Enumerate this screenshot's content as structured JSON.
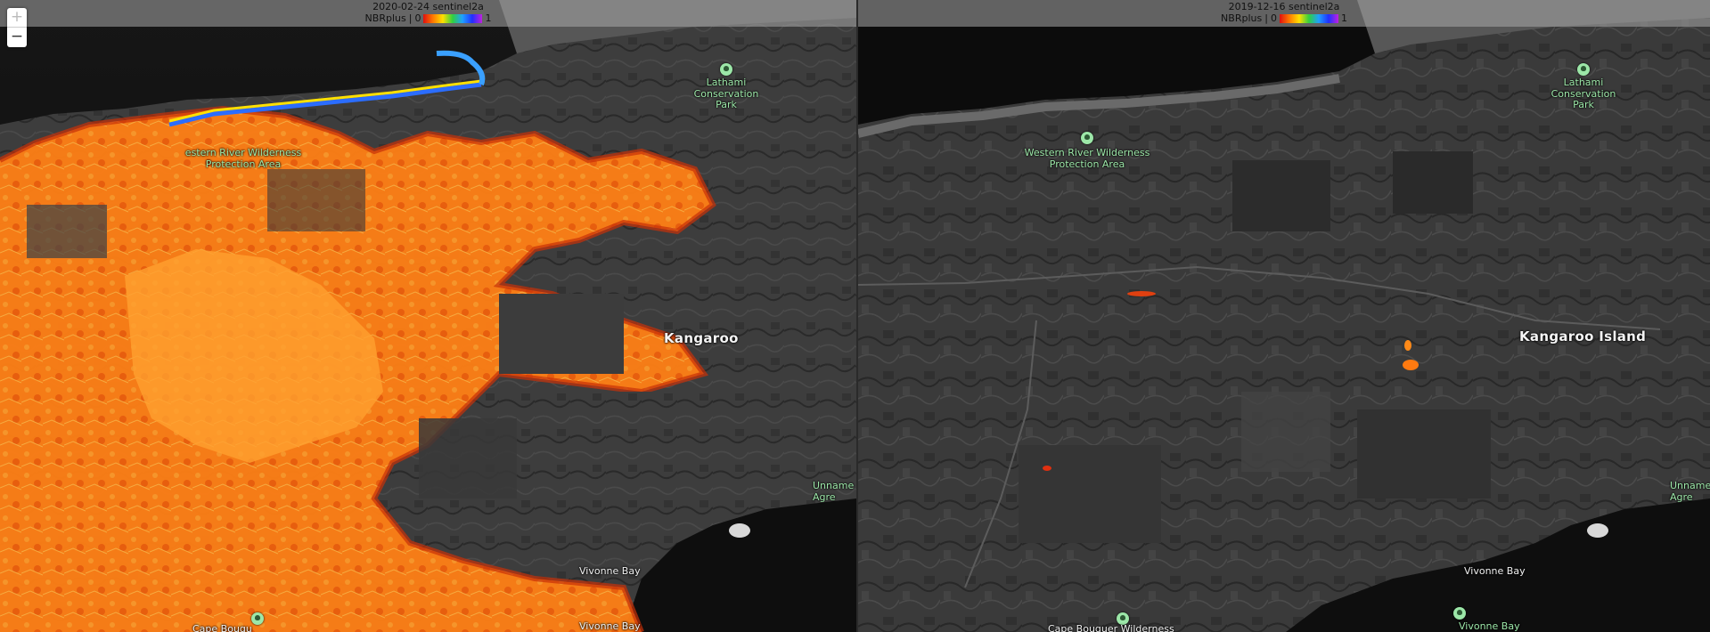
{
  "left_map": {
    "date": "2020-02-24",
    "sensor": "sentinel2a",
    "legend": {
      "index": "NBRplus",
      "min": "0",
      "max": "1",
      "separator": "|"
    }
  },
  "right_map": {
    "date": "2019-12-16",
    "sensor": "sentinel2a",
    "legend": {
      "index": "NBRplus",
      "min": "0",
      "max": "1",
      "separator": "|"
    }
  },
  "zoom": {
    "in_label": "+",
    "out_label": "−"
  },
  "labels": {
    "lathami": [
      "Lathami",
      "Conservation",
      "Park"
    ],
    "western_river": [
      "Western River Wilderness",
      "Protection Area"
    ],
    "western_river_left": [
      "estern River Wilderness",
      "Protection Area"
    ],
    "kangaroo_island": "Kangaroo Island",
    "kangaroo_island_left": "Kangaroo",
    "unnamed_right": [
      "Unname",
      "Agre"
    ],
    "vivonne_bay": "Vivonne Bay",
    "cape_bouguer": "Cape Bouguer Wilderness",
    "cape_bouguer_left": "Cape Bougu"
  },
  "colors": {
    "burn_core": "#ff8a1a",
    "burn_edge": "#e8420a",
    "label_green": "#9ce7a8",
    "water": "#0c0c0c",
    "land": "#3a3a3a"
  }
}
